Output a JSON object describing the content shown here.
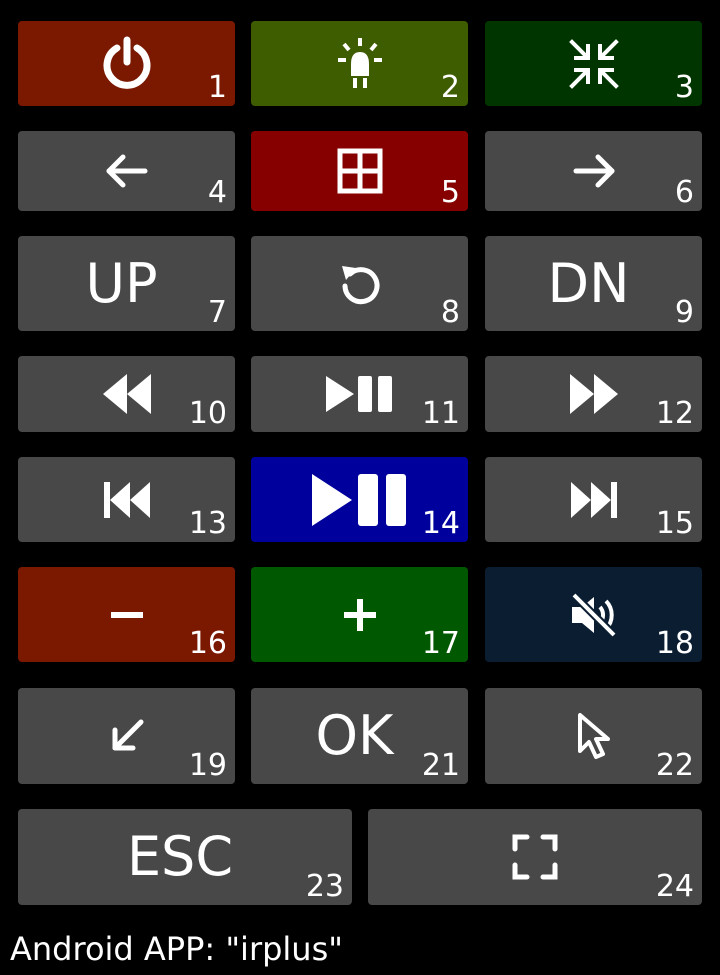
{
  "colors": {
    "background": "#000000",
    "default_button": "#484848",
    "power": "#7a1800",
    "light": "#3e5c00",
    "compress": "#003500",
    "menu": "#860000",
    "play_pause_main": "#00009c",
    "volume_down": "#7a1800",
    "volume_up": "#005800",
    "mute": "#0b1e31"
  },
  "buttons": [
    {
      "id": "b1",
      "num": "1",
      "icon": "power-icon"
    },
    {
      "id": "b2",
      "num": "2",
      "icon": "light-bulb-icon"
    },
    {
      "id": "b3",
      "num": "3",
      "icon": "compress-arrows-icon"
    },
    {
      "id": "b4",
      "num": "4",
      "icon": "arrow-left-icon"
    },
    {
      "id": "b5",
      "num": "5",
      "icon": "grid-menu-icon"
    },
    {
      "id": "b6",
      "num": "6",
      "icon": "arrow-right-icon"
    },
    {
      "id": "b7",
      "num": "7",
      "label": "UP"
    },
    {
      "id": "b8",
      "num": "8",
      "icon": "undo-icon"
    },
    {
      "id": "b9",
      "num": "9",
      "label": "DN"
    },
    {
      "id": "b10",
      "num": "10",
      "icon": "rewind-icon"
    },
    {
      "id": "b11",
      "num": "11",
      "icon": "play-pause-icon"
    },
    {
      "id": "b12",
      "num": "12",
      "icon": "fast-forward-icon"
    },
    {
      "id": "b13",
      "num": "13",
      "icon": "skip-previous-icon"
    },
    {
      "id": "b14",
      "num": "14",
      "icon": "play-pause-icon"
    },
    {
      "id": "b15",
      "num": "15",
      "icon": "skip-next-icon"
    },
    {
      "id": "b16",
      "num": "16",
      "icon": "minus-icon"
    },
    {
      "id": "b17",
      "num": "17",
      "icon": "plus-icon"
    },
    {
      "id": "b18",
      "num": "18",
      "icon": "volume-mute-icon"
    },
    {
      "id": "b19",
      "num": "19",
      "icon": "arrow-down-left-icon"
    },
    {
      "id": "b21",
      "num": "21",
      "label": "OK"
    },
    {
      "id": "b22",
      "num": "22",
      "icon": "cursor-pointer-icon"
    },
    {
      "id": "b23",
      "num": "23",
      "label": "ESC"
    },
    {
      "id": "b24",
      "num": "24",
      "icon": "fullscreen-icon"
    }
  ],
  "footer": {
    "text": "Android APP: \"irplus\""
  }
}
